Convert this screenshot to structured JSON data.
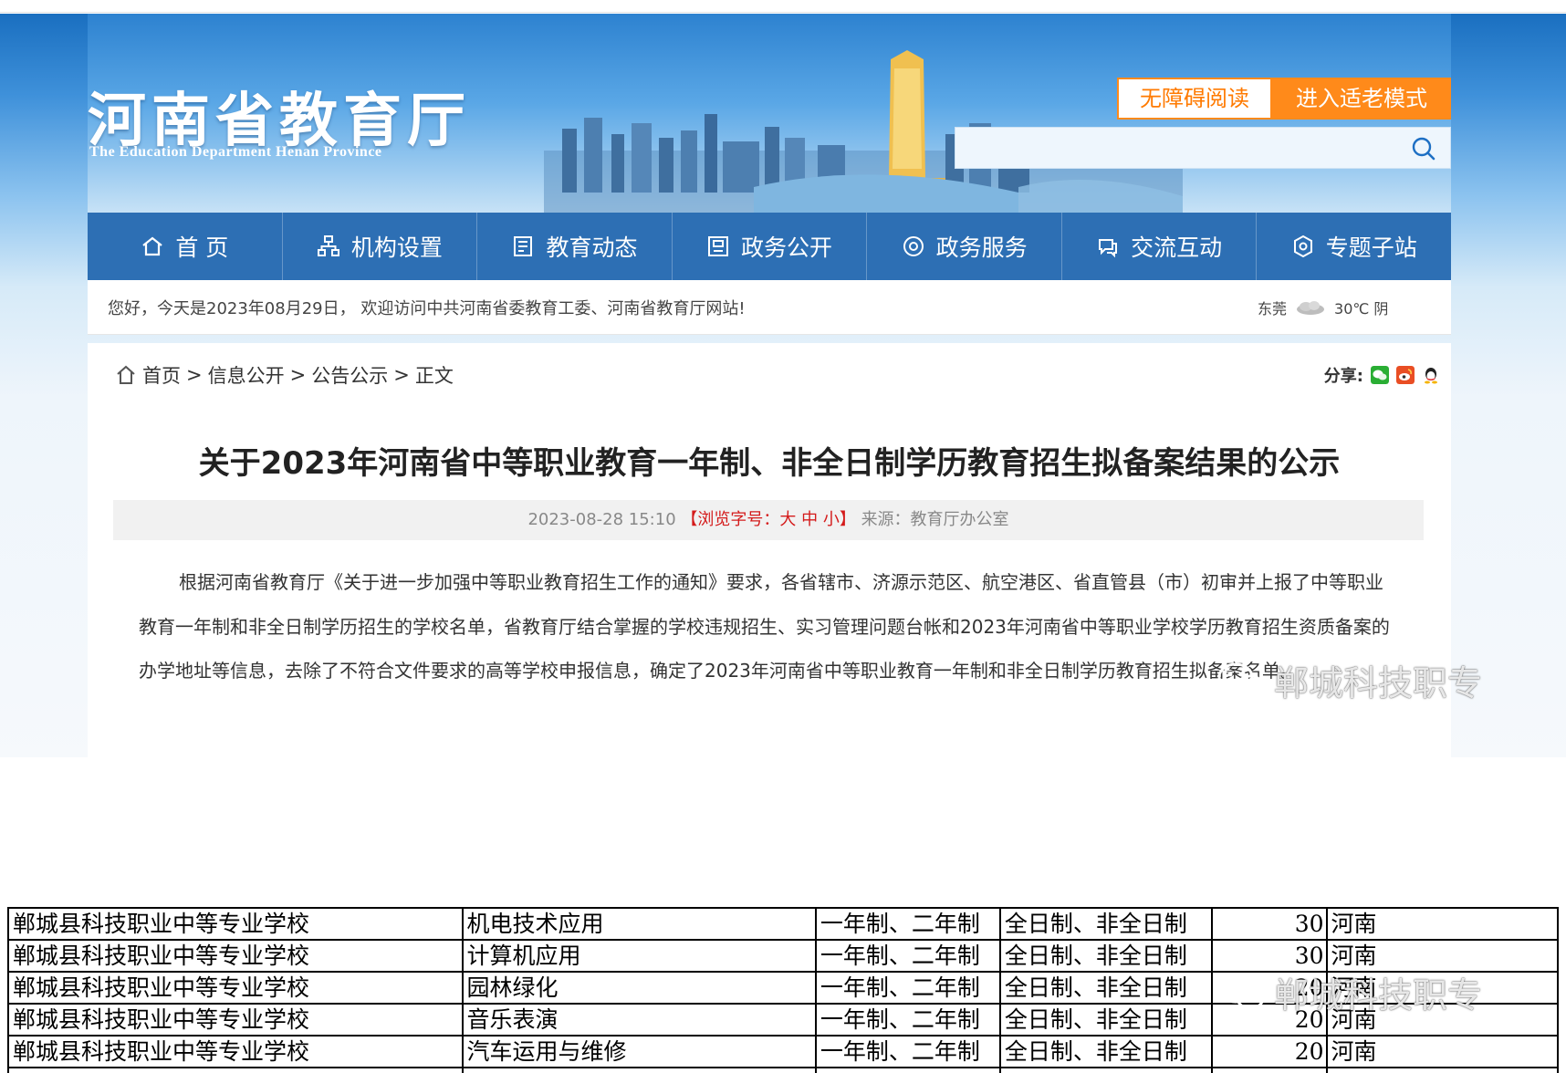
{
  "header": {
    "site_title": "河南省教育厅",
    "site_subtitle": "The Education Department Henan Province",
    "accessibility_button": "无障碍阅读",
    "elder_mode_button": "进入适老模式",
    "search_placeholder": ""
  },
  "nav": {
    "items": [
      {
        "label": "首 页",
        "icon": "home-icon"
      },
      {
        "label": "机构设置",
        "icon": "org-chart-icon"
      },
      {
        "label": "教育动态",
        "icon": "news-icon"
      },
      {
        "label": "政务公开",
        "icon": "gov-info-icon"
      },
      {
        "label": "政务服务",
        "icon": "service-icon"
      },
      {
        "label": "交流互动",
        "icon": "interaction-icon"
      },
      {
        "label": "专题子站",
        "icon": "topic-icon"
      }
    ]
  },
  "welcome": {
    "text": "您好，今天是2023年08月29日， 欢迎访问中共河南省委教育工委、河南省教育厅网站!",
    "city": "东莞",
    "weather": "30℃ 阴"
  },
  "breadcrumb": {
    "items": [
      "首页",
      "信息公开",
      "公告公示"
    ],
    "current": "正文",
    "sep": ">"
  },
  "share": {
    "label": "分享:",
    "icons": [
      "wechat-icon",
      "weibo-icon",
      "qq-icon"
    ]
  },
  "article": {
    "title": "关于2023年河南省中等职业教育一年制、非全日制学历教育招生拟备案结果的公示",
    "datetime": "2023-08-28 15:10",
    "font_size_label": "【浏览字号：大 中 小】",
    "source": "来源：教育厅办公室",
    "body": "根据河南省教育厅《关于进一步加强中等职业教育招生工作的通知》要求，各省辖市、济源示范区、航空港区、省直管县（市）初审并上报了中等职业教育一年制和非全日制学历招生的学校名单，省教育厅结合掌握的学校违规招生、实习管理问题台帐和2023年河南省中等职业学校学历教育招生资质备案的办学地址等信息，去除了不符合文件要求的高等学校申报信息，确定了2023年河南省中等职业教育一年制和非全日制学历教育招生拟备案名单。"
  },
  "watermark": {
    "text": "郸城科技职专"
  },
  "table": {
    "rows": [
      [
        "郸城县科技职业中等专业学校",
        "机电技术应用",
        "一年制、二年制",
        "全日制、非全日制",
        "30",
        "河南"
      ],
      [
        "郸城县科技职业中等专业学校",
        "计算机应用",
        "一年制、二年制",
        "全日制、非全日制",
        "30",
        "河南"
      ],
      [
        "郸城县科技职业中等专业学校",
        "园林绿化",
        "一年制、二年制",
        "全日制、非全日制",
        "20",
        "河南"
      ],
      [
        "郸城县科技职业中等专业学校",
        "音乐表演",
        "一年制、二年制",
        "全日制、非全日制",
        "20",
        "河南"
      ],
      [
        "郸城县科技职业中等专业学校",
        "汽车运用与维修",
        "一年制、二年制",
        "全日制、非全日制",
        "20",
        "河南"
      ],
      [
        "",
        "",
        "",
        "",
        "",
        ""
      ]
    ]
  },
  "colors": {
    "nav_bg": "#2d6fb4",
    "orange": "#ff8a1a",
    "red": "#d41b1b"
  }
}
